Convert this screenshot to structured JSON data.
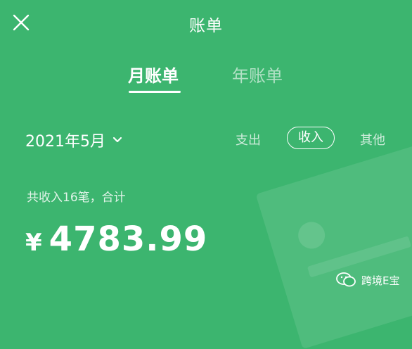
{
  "header": {
    "title": "账单",
    "close_icon": "close-icon"
  },
  "tabs": [
    {
      "label": "月账单",
      "active": true
    },
    {
      "label": "年账单",
      "active": false
    }
  ],
  "filter": {
    "month": "2021年5月",
    "options": [
      {
        "label": "支出",
        "selected": false
      },
      {
        "label": "收入",
        "selected": true
      },
      {
        "label": "其他",
        "selected": false
      }
    ]
  },
  "summary": {
    "text": "共收入16笔，合计",
    "currency": "¥",
    "amount": "4783.99"
  },
  "watermark": {
    "text": "跨境E宝"
  },
  "colors": {
    "background": "#3cb56f",
    "text": "#ffffff"
  }
}
